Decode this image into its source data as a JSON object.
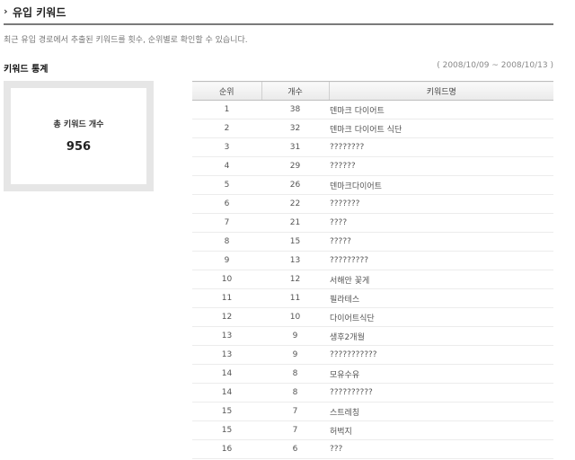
{
  "header": {
    "arrow": "›",
    "title": "유입 키워드"
  },
  "description": "최근 유입 경로에서 추출된 키워드를 횟수, 순위별로 확인할 수 있습니다.",
  "stats": {
    "title": "키워드 통계",
    "date_range": "( 2008/10/09 ~ 2008/10/13 )",
    "total_label": "총 키워드 개수",
    "total_value": "956"
  },
  "table": {
    "columns": [
      "순위",
      "개수",
      "키워드명"
    ],
    "rows": [
      [
        "1",
        "38",
        "덴마크 다이어트"
      ],
      [
        "2",
        "32",
        "덴마크 다이어트 식단"
      ],
      [
        "3",
        "31",
        "????????"
      ],
      [
        "4",
        "29",
        "??????"
      ],
      [
        "5",
        "26",
        "덴마크다이어트"
      ],
      [
        "6",
        "22",
        "???????"
      ],
      [
        "7",
        "21",
        "????"
      ],
      [
        "8",
        "15",
        "?????"
      ],
      [
        "9",
        "13",
        "?????????"
      ],
      [
        "10",
        "12",
        "서해안 꽃게"
      ],
      [
        "11",
        "11",
        "필라테스"
      ],
      [
        "12",
        "10",
        "다이어트식단"
      ],
      [
        "13",
        "9",
        "생후2개월"
      ],
      [
        "13",
        "9",
        "???????????"
      ],
      [
        "14",
        "8",
        "모유수유"
      ],
      [
        "14",
        "8",
        "??????????"
      ],
      [
        "15",
        "7",
        "스트레칭"
      ],
      [
        "15",
        "7",
        "허벅지"
      ],
      [
        "16",
        "6",
        "???"
      ]
    ]
  }
}
